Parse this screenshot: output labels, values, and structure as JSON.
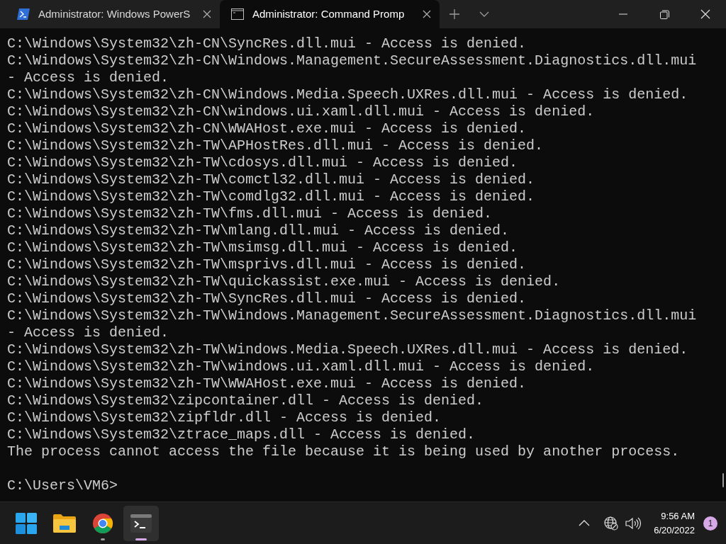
{
  "tabs": [
    {
      "title": "Administrator: Windows PowerS",
      "kind": "powershell",
      "selected": false
    },
    {
      "title": "Administrator: Command Promp",
      "kind": "cmd",
      "selected": true
    }
  ],
  "console": {
    "lines": [
      {
        "kind": "output",
        "text": "C:\\Windows\\System32\\zh-CN\\SyncRes.dll.mui - Access is denied."
      },
      {
        "kind": "output",
        "text": "C:\\Windows\\System32\\zh-CN\\Windows.Management.SecureAssessment.Diagnostics.dll.mui"
      },
      {
        "kind": "output",
        "text": "- Access is denied."
      },
      {
        "kind": "output",
        "text": "C:\\Windows\\System32\\zh-CN\\Windows.Media.Speech.UXRes.dll.mui - Access is denied."
      },
      {
        "kind": "output",
        "text": "C:\\Windows\\System32\\zh-CN\\windows.ui.xaml.dll.mui - Access is denied."
      },
      {
        "kind": "output",
        "text": "C:\\Windows\\System32\\zh-CN\\WWAHost.exe.mui - Access is denied."
      },
      {
        "kind": "output",
        "text": "C:\\Windows\\System32\\zh-TW\\APHostRes.dll.mui - Access is denied."
      },
      {
        "kind": "output",
        "text": "C:\\Windows\\System32\\zh-TW\\cdosys.dll.mui - Access is denied."
      },
      {
        "kind": "output",
        "text": "C:\\Windows\\System32\\zh-TW\\comctl32.dll.mui - Access is denied."
      },
      {
        "kind": "output",
        "text": "C:\\Windows\\System32\\zh-TW\\comdlg32.dll.mui - Access is denied."
      },
      {
        "kind": "output",
        "text": "C:\\Windows\\System32\\zh-TW\\fms.dll.mui - Access is denied."
      },
      {
        "kind": "output",
        "text": "C:\\Windows\\System32\\zh-TW\\mlang.dll.mui - Access is denied."
      },
      {
        "kind": "output",
        "text": "C:\\Windows\\System32\\zh-TW\\msimsg.dll.mui - Access is denied."
      },
      {
        "kind": "output",
        "text": "C:\\Windows\\System32\\zh-TW\\msprivs.dll.mui - Access is denied."
      },
      {
        "kind": "output",
        "text": "C:\\Windows\\System32\\zh-TW\\quickassist.exe.mui - Access is denied."
      },
      {
        "kind": "output",
        "text": "C:\\Windows\\System32\\zh-TW\\SyncRes.dll.mui - Access is denied."
      },
      {
        "kind": "output",
        "text": "C:\\Windows\\System32\\zh-TW\\Windows.Management.SecureAssessment.Diagnostics.dll.mui"
      },
      {
        "kind": "output",
        "text": "- Access is denied."
      },
      {
        "kind": "output",
        "text": "C:\\Windows\\System32\\zh-TW\\Windows.Media.Speech.UXRes.dll.mui - Access is denied."
      },
      {
        "kind": "output",
        "text": "C:\\Windows\\System32\\zh-TW\\windows.ui.xaml.dll.mui - Access is denied."
      },
      {
        "kind": "output",
        "text": "C:\\Windows\\System32\\zh-TW\\WWAHost.exe.mui - Access is denied."
      },
      {
        "kind": "output",
        "text": "C:\\Windows\\System32\\zipcontainer.dll - Access is denied."
      },
      {
        "kind": "output",
        "text": "C:\\Windows\\System32\\zipfldr.dll - Access is denied."
      },
      {
        "kind": "output",
        "text": "C:\\Windows\\System32\\ztrace_maps.dll - Access is denied."
      },
      {
        "kind": "output",
        "text": "The process cannot access the file because it is being used by another process."
      },
      {
        "kind": "prompt",
        "text": "C:\\Users\\VM6>"
      }
    ]
  },
  "taskbar": {
    "apps": [
      {
        "kind": "start",
        "selected": false
      },
      {
        "kind": "explorer",
        "selected": false
      },
      {
        "kind": "chrome",
        "selected": false,
        "running": true
      },
      {
        "kind": "terminal",
        "selected": true,
        "running": true
      }
    ],
    "time": "9:56 AM",
    "date": "6/20/2022",
    "notifications": "1"
  }
}
